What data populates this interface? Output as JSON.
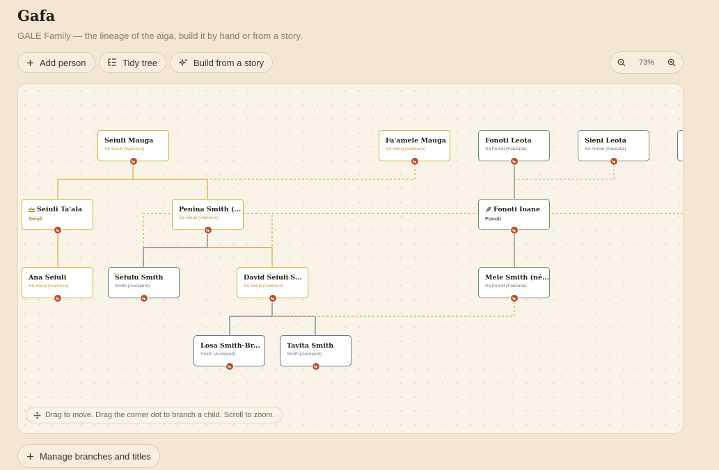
{
  "app": {
    "title": "Gafa",
    "subtitle": "GALE Family — the lineage of the aiga, build it by hand or from a story."
  },
  "toolbar": {
    "add_person": "Add person",
    "tidy_tree": "Tidy tree",
    "build_story": "Build from a story"
  },
  "zoom": {
    "level": "73%"
  },
  "colors": {
    "seiuli_branch": "#d7ab3c",
    "fonoti_branch": "#6e8a6a",
    "smith_branch": "#6a7590",
    "branch_dot": "#b5502e"
  },
  "people": [
    {
      "id": "p0",
      "name": "Seiuli Mauga",
      "sub": "Sā Seiuli (Vaimoso)",
      "branch": "gold"
    },
    {
      "id": "p1",
      "name": "Fa'amele Mauga",
      "sub": "Sā Seiuli (Vaimoso)",
      "branch": "gold"
    },
    {
      "id": "p2",
      "name": "Fonoti Leota",
      "sub": "Sā Fonoti (Faleīatai)",
      "branch": "green"
    },
    {
      "id": "p3",
      "name": "Sieni Leota",
      "sub": "Sā Fonoti (Faleīatai)",
      "branch": "green"
    },
    {
      "id": "p4",
      "name": "Seiuli Ta'ala",
      "sub": "Seiuli",
      "branch": "gold",
      "icon": "crown-icon"
    },
    {
      "id": "p5",
      "name": "Penina Smith (...",
      "sub": "Sā Seiuli (Vaimoso)",
      "branch": "gold"
    },
    {
      "id": "p6",
      "name": "Fonoti Ioane",
      "sub": "Fonoti",
      "branch": "green",
      "icon": "feather-icon"
    },
    {
      "id": "p7",
      "name": "Ana Seiuli",
      "sub": "Sā Seiuli (Vaimoso)",
      "branch": "gold"
    },
    {
      "id": "p8",
      "name": "Sefulu Smith",
      "sub": "Smith (Auckland)",
      "branch": "slate"
    },
    {
      "id": "p9",
      "name": "David Seiuli S...",
      "sub": "Sā Seiuli (Vaimoso)",
      "branch": "gold"
    },
    {
      "id": "p10",
      "name": "Mele Smith (né...",
      "sub": "Sā Fonoti (Faleīatai)",
      "branch": "green"
    },
    {
      "id": "p11",
      "name": "Losa Smith-Br...",
      "sub": "Smith (Auckland)",
      "branch": "slate"
    },
    {
      "id": "p12",
      "name": "Tavita Smith",
      "sub": "Smith (Auckland)",
      "branch": "slate"
    }
  ],
  "hint": "Drag to move. Drag the corner dot to branch a child. Scroll to zoom.",
  "footer": {
    "manage_branches": "Manage branches and titles"
  }
}
